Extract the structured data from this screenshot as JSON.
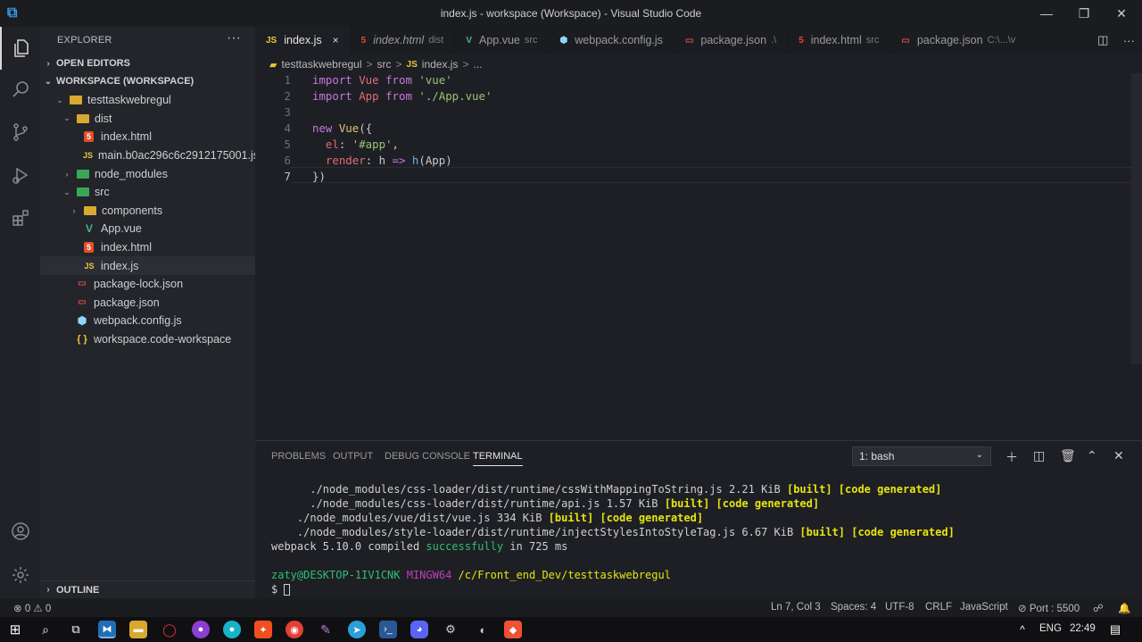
{
  "window": {
    "title": "index.js - workspace (Workspace) - Visual Studio Code"
  },
  "sidebar": {
    "title": "EXPLORER",
    "more": "···",
    "open_editors": "OPEN EDITORS",
    "workspace": "WORKSPACE (WORKSPACE)",
    "outline": "OUTLINE",
    "tree": [
      {
        "label": "testtaskwebregul",
        "icon": "folder-icon"
      },
      {
        "label": "dist",
        "icon": "folder-icon"
      },
      {
        "label": "index.html",
        "icon": "html-icon"
      },
      {
        "label": "main.b0ac296c6c2912175001.js",
        "icon": "js-icon"
      },
      {
        "label": "node_modules",
        "icon": "folder-icon"
      },
      {
        "label": "src",
        "icon": "folder-icon"
      },
      {
        "label": "components",
        "icon": "folder-icon"
      },
      {
        "label": "App.vue",
        "icon": "vue-icon"
      },
      {
        "label": "index.html",
        "icon": "html-icon"
      },
      {
        "label": "index.js",
        "icon": "js-icon"
      },
      {
        "label": "package-lock.json",
        "icon": "json-icon"
      },
      {
        "label": "package.json",
        "icon": "json-icon"
      },
      {
        "label": "webpack.config.js",
        "icon": "webpack-icon"
      },
      {
        "label": "workspace.code-workspace",
        "icon": "braces-icon"
      }
    ]
  },
  "tabs": [
    {
      "label": "index.js",
      "desc": "",
      "icon": "JS"
    },
    {
      "label": "index.html",
      "desc": "dist",
      "icon": "5"
    },
    {
      "label": "App.vue",
      "desc": "src",
      "icon": "V"
    },
    {
      "label": "webpack.config.js",
      "desc": "",
      "icon": "⬢"
    },
    {
      "label": "package.json",
      "desc": ".\\",
      "icon": "▭"
    },
    {
      "label": "index.html",
      "desc": "src",
      "icon": "5"
    },
    {
      "label": "package.json",
      "desc": "C:\\...\\v",
      "icon": "▭"
    }
  ],
  "tab_close": "×",
  "breadcrumb": {
    "root": "testtaskwebregul",
    "sep": ">",
    "folder": "src",
    "file": "index.js",
    "tail": "..."
  },
  "editor": {
    "line_numbers": [
      "1",
      "2",
      "3",
      "4",
      "5",
      "6",
      "7"
    ],
    "lines": {
      "l1": {
        "a": "import",
        "b": " Vue ",
        "c": "from",
        "d": " 'vue'"
      },
      "l2": {
        "a": "import",
        "b": " App ",
        "c": "from",
        "d": " './App.vue'"
      },
      "l4": {
        "a": "new",
        "b": " Vue",
        "c": "({"
      },
      "l5": {
        "a": "  el",
        "b": ": ",
        "c": "'#app'",
        "d": ","
      },
      "l6": {
        "a": "  render",
        "b": ": h ",
        "c": "=>",
        "d": " h",
        "e": "(App)"
      },
      "l7": {
        "a": "})"
      }
    }
  },
  "panel": {
    "tabs": [
      "PROBLEMS",
      "OUTPUT",
      "DEBUG CONSOLE",
      "TERMINAL"
    ],
    "terminal_select": "1: bash",
    "terminal": [
      {
        "path": "      ./node_modules/css-loader/dist/runtime/cssWithMappingToString.js",
        "size": " 2.21 KiB ",
        "tags": "[built] [code generated]"
      },
      {
        "path": "      ./node_modules/css-loader/dist/runtime/api.js",
        "size": " 1.57 KiB ",
        "tags": "[built] [code generated]"
      },
      {
        "path": "    ./node_modules/vue/dist/vue.js",
        "size": " 334 KiB ",
        "tags": "[built] [code generated]"
      },
      {
        "path": "    ./node_modules/style-loader/dist/runtime/injectStylesIntoStyleTag.js",
        "size": " 6.67 KiB ",
        "tags": "[built] [code generated]"
      }
    ],
    "compiled": {
      "a": "webpack 5.10.0 compiled ",
      "b": "successfully",
      "c": " in 725 ms"
    },
    "prompt": {
      "user": "zaty@DESKTOP-1IV1CNK",
      "env": " MINGW64",
      "path": " /c/Front_end_Dev/testtaskwebregul"
    },
    "dollar": "$"
  },
  "status": {
    "problems": "⊗ 0 ⚠ 0",
    "position": "Ln 7, Col 3",
    "spaces": "Spaces: 4",
    "encoding": "UTF-8",
    "eol": "CRLF",
    "language": "JavaScript",
    "port": "⊘ Port : 5500"
  },
  "taskbar": {
    "lang": "ENG",
    "time": "22:49"
  }
}
